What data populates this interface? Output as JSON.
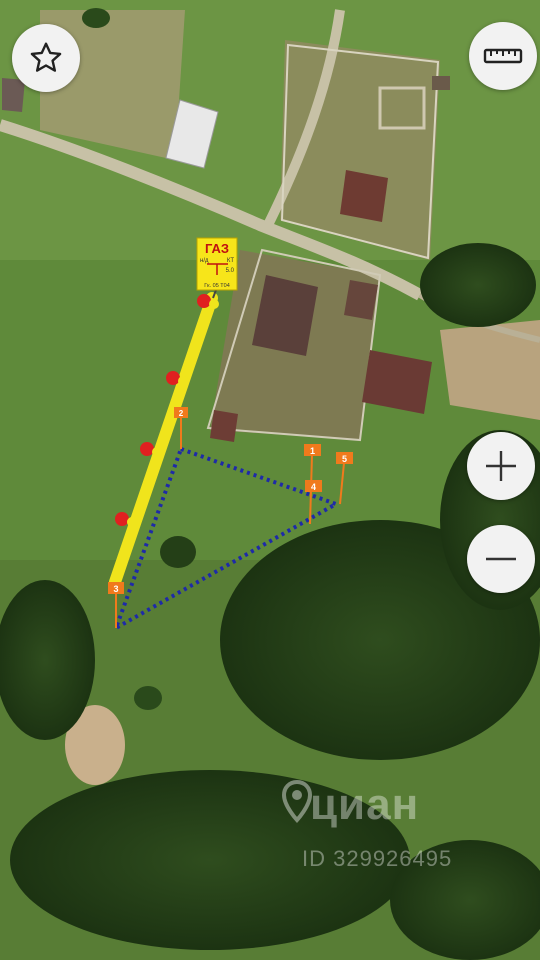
{
  "map": {
    "gas_sign": {
      "title": "ГАЗ",
      "left_label": "н/д",
      "right_label": "КТ",
      "value": "5.0",
      "code": "Гк. 05 Т04"
    },
    "plot_markers": [
      "1",
      "2",
      "3",
      "4",
      "5"
    ]
  },
  "controls": {
    "favorite_icon": "star-icon",
    "ruler_icon": "ruler-icon",
    "zoom_in_icon": "plus-icon",
    "zoom_out_icon": "minus-icon"
  },
  "watermark": {
    "brand": "циан",
    "listing_id": "ID 329926495"
  },
  "colors": {
    "gas_pipe": "#f0e41c",
    "boundary": "#1e2aa8",
    "marker": "#f07a1c",
    "button_bg": "#f2f2f2"
  }
}
